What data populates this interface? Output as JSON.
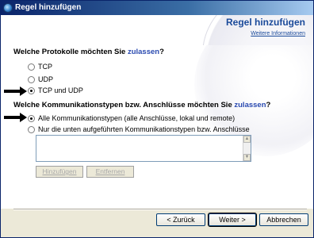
{
  "window": {
    "title": "Regel hinzufügen"
  },
  "header": {
    "title": "Regel hinzufügen",
    "link": "Weitere Informationen"
  },
  "protocols": {
    "question_prefix": "Welche Protokolle möchten Sie ",
    "question_accent": "zulassen",
    "question_suffix": "?",
    "options": [
      {
        "label": "TCP",
        "selected": false
      },
      {
        "label": "UDP",
        "selected": false
      },
      {
        "label": "TCP und UDP",
        "selected": true
      }
    ]
  },
  "communication": {
    "question_prefix": "Welche Kommunikationstypen bzw. Anschlüsse möchten Sie ",
    "question_accent": "zulassen",
    "question_suffix": "?",
    "options": [
      {
        "label": "Alle Kommunikationstypen (alle Anschlüsse, lokal und remote)",
        "selected": true
      },
      {
        "label": "Nur die unten aufgeführten Kommunikationstypen bzw. Anschlüsse",
        "selected": false
      }
    ],
    "add_label": "Hinzufügen",
    "remove_label": "Entfernen"
  },
  "footer": {
    "back_label": "< Zurück",
    "next_label": "Weiter >",
    "cancel_label": "Abbrechen"
  }
}
